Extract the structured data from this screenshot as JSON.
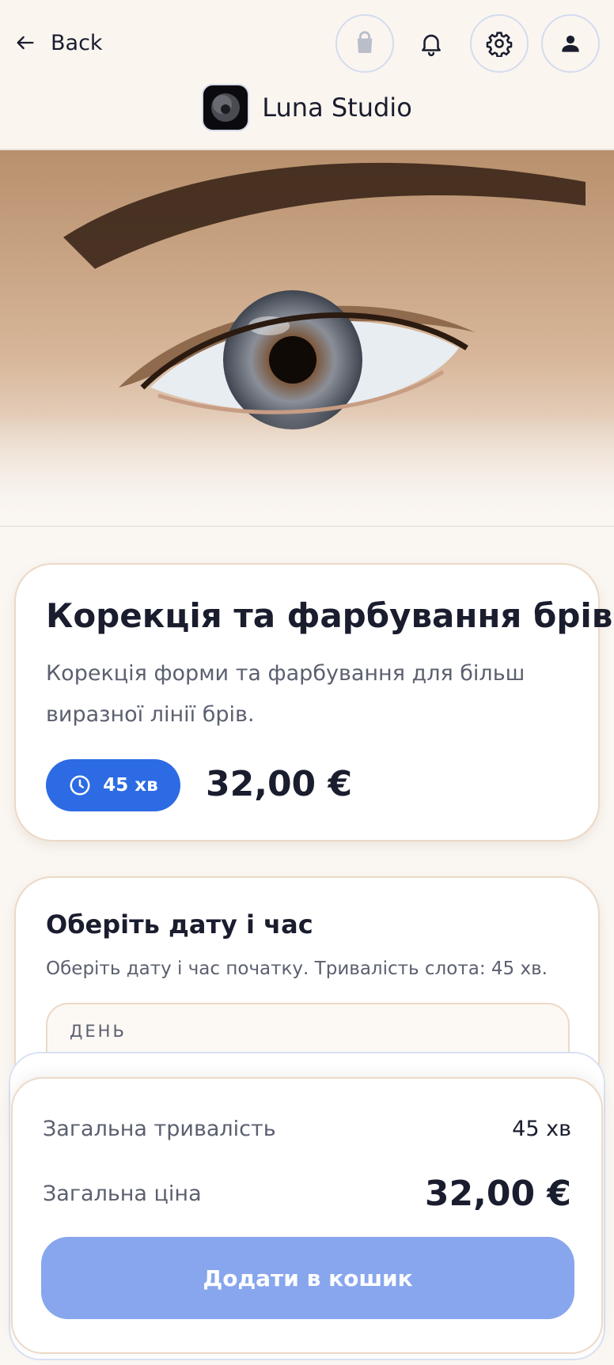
{
  "header": {
    "back_label": "Back",
    "brand_name": "Luna Studio",
    "icons": [
      "shopping-bag-icon",
      "bell-icon",
      "gear-icon",
      "user-icon"
    ]
  },
  "service": {
    "title": "Корекція та фарбування брів",
    "description": "Корекція форми та фарбування для більш виразної лінії брів.",
    "duration": "45 хв",
    "price": "32,00 €"
  },
  "booking": {
    "title": "Оберіть дату і час",
    "subtitle": "Оберіть дату і час початку. Тривалість слота: 45 хв.",
    "day_label": "ДЕНЬ"
  },
  "summary": {
    "duration_label": "Загальна тривалість",
    "duration_value": "45 хв",
    "price_label": "Загальна ціна",
    "price_value": "32,00 €",
    "add_to_cart_label": "Додати в кошик"
  },
  "colors": {
    "accent": "#2d6be4",
    "button_disabled": "#88a6ee",
    "background": "#faf6f2",
    "card_border": "#ecd9c6"
  }
}
